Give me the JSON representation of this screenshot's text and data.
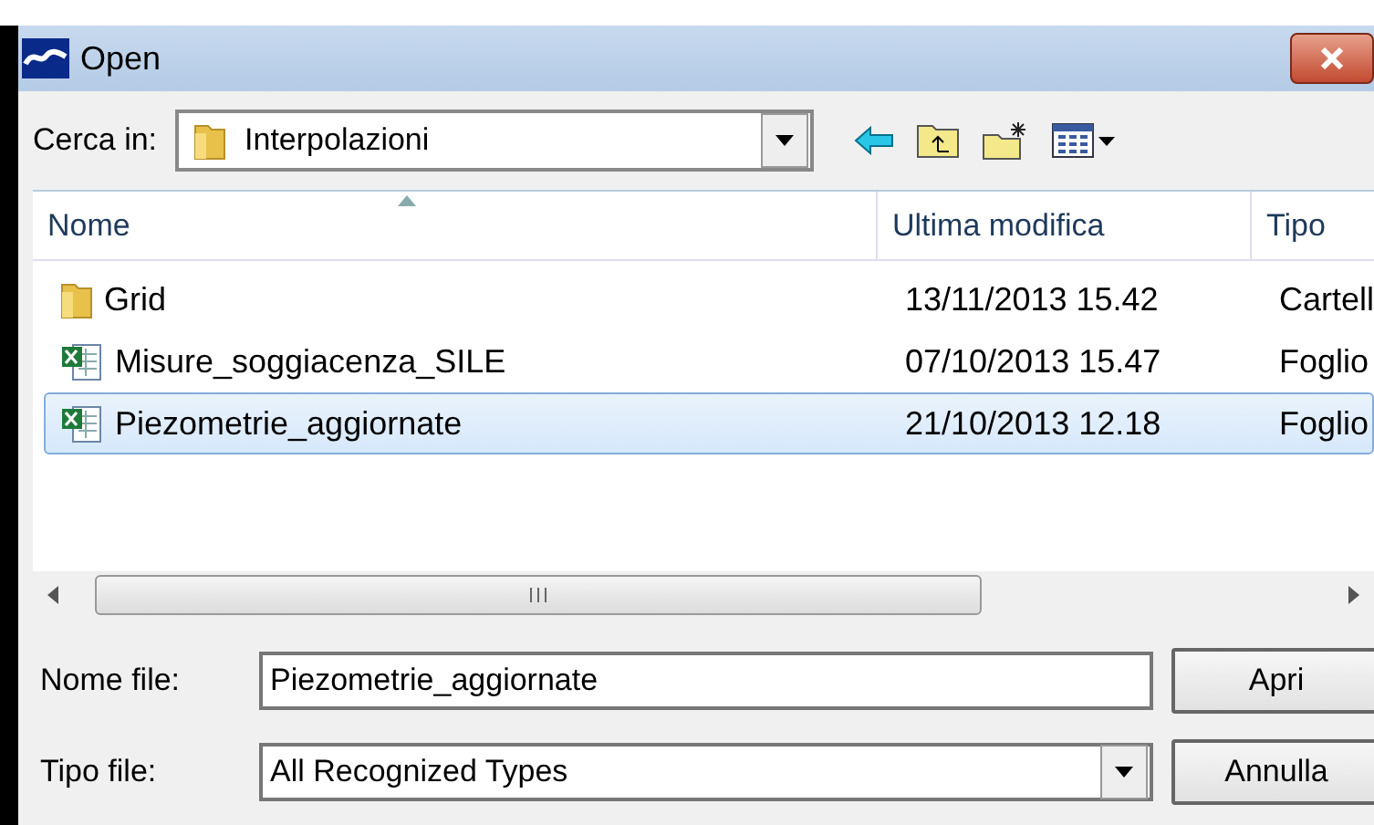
{
  "window": {
    "title": "Open"
  },
  "look_in": {
    "label": "Cerca in:",
    "value": "Interpolazioni"
  },
  "table": {
    "columns": [
      {
        "label": "Nome",
        "sorted": true
      },
      {
        "label": "Ultima modifica",
        "sorted": false
      },
      {
        "label": "Tipo",
        "sorted": false
      }
    ],
    "rows": [
      {
        "kind": "folder",
        "name": "Grid",
        "modified": "13/11/2013 15.42",
        "type": "Cartell",
        "selected": false
      },
      {
        "kind": "sheet",
        "name": "Misure_soggiacenza_SILE",
        "modified": "07/10/2013 15.47",
        "type": "Foglio",
        "selected": false
      },
      {
        "kind": "sheet",
        "name": "Piezometrie_aggiornate",
        "modified": "21/10/2013 12.18",
        "type": "Foglio",
        "selected": true
      }
    ]
  },
  "file_name": {
    "label": "Nome file:",
    "value": "Piezometrie_aggiornate"
  },
  "file_type": {
    "label": "Tipo file:",
    "value": "All Recognized Types"
  },
  "buttons": [
    "Apri",
    "Annulla"
  ]
}
